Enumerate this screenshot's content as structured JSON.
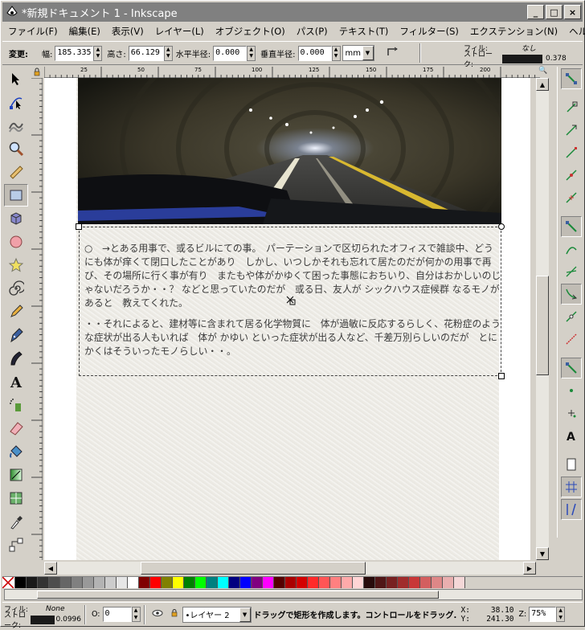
{
  "window": {
    "title": "*新規ドキュメント 1 - Inkscape",
    "minimize": "_",
    "maximize": "□",
    "close": "×"
  },
  "menu": [
    "ファイル(F)",
    "編集(E)",
    "表示(V)",
    "レイヤー(L)",
    "オブジェクト(O)",
    "パス(P)",
    "テキスト(T)",
    "フィルター(S)",
    "エクステンション(N)",
    "ヘルプ(H)"
  ],
  "controls": {
    "change_label": "変更:",
    "width_label": "幅:",
    "width_value": "185.335",
    "height_label": "高さ:",
    "height_value": "66.129",
    "rx_label": "水平半径:",
    "rx_value": "0.000",
    "ry_label": "垂直半径:",
    "ry_value": "0.000",
    "unit": "mm"
  },
  "fillstroke_top": {
    "fill_label": "フィル:",
    "fill_value": "なし",
    "stroke_label": "ストローク:",
    "stroke_width": "0.378"
  },
  "ruler": {
    "ticks": [
      "25",
      "50",
      "75",
      "100",
      "125",
      "150",
      "175",
      "200"
    ]
  },
  "canvas_text": {
    "paragraph1": "○　→とある用事で、或るビルにての事。　パーテーションで区切られたオフィスで雑談中、どうにも体が痒くて閉口したことがあり　しかし、いつしかそれも忘れて居たのだが何かの用事で再び、その場所に行く事が有り　またもや体がかゆくて困った事態におちいり、自分はおかしいのじゃないだろうか・・？ などと思っていたのだが　或る日、友人が シックハウス症候群 なるモノがあると　教えてくれた。",
    "paragraph2": "・・それによると、建材等に含まれて居る化学物質に　体が過敏に反応するらしく、花粉症のような症状が出る人もいれば　体が かゆい といった症状が出る人など、千差万別らしいのだが　とにかくはそういったモノらしい・・。"
  },
  "statusbar": {
    "fill_label": "フィル:",
    "fill_value": "None",
    "stroke_label": "ストローク:",
    "stroke_width": "0.0996",
    "opacity_label": "O:",
    "opacity_value": "0",
    "layer": "•レイヤー 2",
    "message": "ドラッグで矩形を作成します。コントロールをドラッグ...",
    "x_label": "X:",
    "x_value": "38.10",
    "y_label": "Y:",
    "y_value": "241.30",
    "zoom_label": "Z:",
    "zoom_value": "75%"
  },
  "palette_colors": [
    "#000000",
    "#1a1a1a",
    "#333333",
    "#4d4d4d",
    "#666666",
    "#808080",
    "#999999",
    "#b3b3b3",
    "#cccccc",
    "#e6e6e6",
    "#ffffff",
    "#800000",
    "#ff0000",
    "#808000",
    "#ffff00",
    "#008000",
    "#00ff00",
    "#008080",
    "#00ffff",
    "#000080",
    "#0000ff",
    "#800080",
    "#ff00ff",
    "#550000",
    "#aa0000",
    "#d40000",
    "#ff2a2a",
    "#ff5555",
    "#ff8080",
    "#ffaaaa",
    "#ffd5d5",
    "#280b0b",
    "#501616",
    "#782121",
    "#a02c2c",
    "#c83737",
    "#d35f5f",
    "#de8787",
    "#e9afaf",
    "#f4d7d7"
  ],
  "colors": {
    "titlebar": "#808080",
    "chrome": "#d4d0c8",
    "selection": "#444444"
  }
}
